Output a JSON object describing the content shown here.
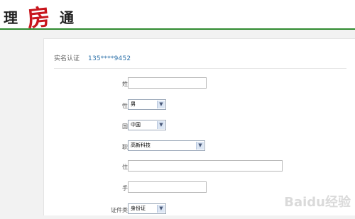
{
  "header": {
    "logo_char_1": "理",
    "logo_char_2": "房",
    "logo_char_3": "通"
  },
  "verification": {
    "label": "实名认证",
    "phone": "135****9452"
  },
  "form": {
    "name_label": "姓名",
    "name_value": "",
    "gender_label": "性别",
    "gender_value": "男",
    "nationality_label": "国籍",
    "nationality_value": "中国",
    "occupation_label": "职业",
    "occupation_value": "高新科技",
    "address_label": "住址",
    "address_value": "",
    "mobile_label": "手机",
    "mobile_value": "",
    "id_type_label": "证件类型",
    "id_type_value": "身份证"
  },
  "watermark": "Baidu经验",
  "colors": {
    "brand_green": "#2f8a2f",
    "logo_red": "#c8161d",
    "phone_blue": "#2a6fa8"
  },
  "icons": {
    "dropdown": "chevron-down-icon"
  }
}
